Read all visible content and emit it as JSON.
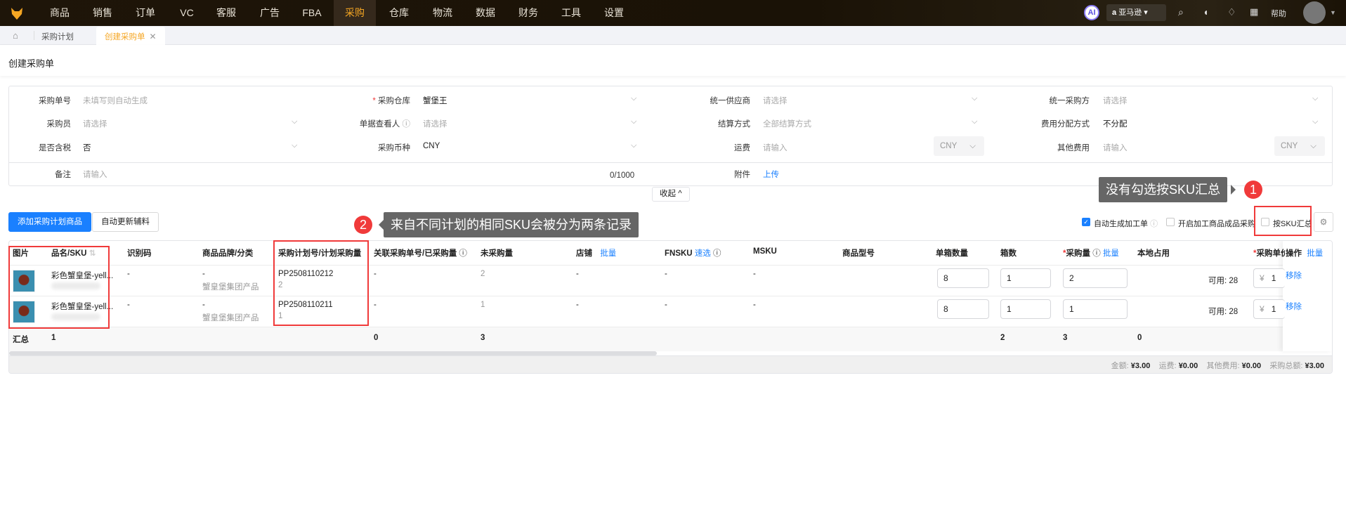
{
  "nav": {
    "items": [
      "商品",
      "销售",
      "订单",
      "VC",
      "客服",
      "广告",
      "FBA",
      "采购",
      "仓库",
      "物流",
      "数据",
      "财务",
      "工具",
      "设置"
    ],
    "active": "采购",
    "ai": "AI",
    "platform": "亚马逊",
    "help": "帮助"
  },
  "tabs": {
    "items": [
      "采购计划",
      "创建采购单"
    ],
    "active": "创建采购单"
  },
  "page_title": "创建采购单",
  "form": {
    "order_no": {
      "label": "采购单号",
      "placeholder": "未填写则自动生成"
    },
    "warehouse": {
      "label": "采购仓库",
      "value": "蟹堡王",
      "required": "*"
    },
    "supplier": {
      "label": "统一供应商",
      "placeholder": "请选择"
    },
    "buyer_party": {
      "label": "统一采购方",
      "placeholder": "请选择"
    },
    "buyer": {
      "label": "采购员",
      "placeholder": "请选择"
    },
    "viewer": {
      "label": "单据查看人",
      "placeholder": "请选择"
    },
    "settlement": {
      "label": "结算方式",
      "placeholder": "全部结算方式"
    },
    "cost_alloc": {
      "label": "费用分配方式",
      "value": "不分配"
    },
    "tax": {
      "label": "是否含税",
      "value": "否"
    },
    "currency": {
      "label": "采购币种",
      "value": "CNY"
    },
    "freight": {
      "label": "运费",
      "placeholder": "请输入",
      "currency": "CNY"
    },
    "other_fee": {
      "label": "其他费用",
      "placeholder": "请输入",
      "currency": "CNY"
    },
    "remark": {
      "label": "备注",
      "placeholder": "请输入",
      "counter": "0/1000"
    },
    "attachment": {
      "label": "附件",
      "upload": "上传"
    },
    "collapse": "收起"
  },
  "toolbar": {
    "add_plan_goods": "添加采购计划商品",
    "auto_update": "自动更新辅料",
    "auto_work_order": "自动生成加工单",
    "finished_purchase": "开启加工商品成品采购",
    "by_sku": "按SKU汇总"
  },
  "table": {
    "headers": {
      "img": "图片",
      "name": "品名/SKU",
      "code": "识别码",
      "brand": "商品品牌/分类",
      "plan": "采购计划号/计划采购量",
      "related": "关联采购单号/已采购量",
      "unpurchased": "未采购量",
      "shop": "店铺",
      "shop_batch": "批量",
      "fnsku": "FNSKU",
      "fnsku_quick": "速选",
      "msku": "MSKU",
      "model": "商品型号",
      "per_box": "单箱数量",
      "boxes": "箱数",
      "qty": "采购量",
      "qty_batch": "批量",
      "local": "本地占用",
      "price": "采购单价",
      "ops": "操作",
      "ops_batch": "批量"
    },
    "rows": [
      {
        "name": "彩色蟹皇堡-yell...",
        "code": "-",
        "brand": "-",
        "category": "蟹皇堡集团产品",
        "plan_no": "PP2508110212",
        "plan_qty": "2",
        "related": "-",
        "unpurchased": "2",
        "shop": "-",
        "fnsku": "-",
        "msku": "-",
        "per_box": "8",
        "boxes": "1",
        "qty": "2",
        "available": "可用: 28",
        "price_prefix": "¥",
        "price": "1",
        "remove": "移除"
      },
      {
        "name": "彩色蟹皇堡-yell...",
        "code": "-",
        "brand": "-",
        "category": "蟹皇堡集团产品",
        "plan_no": "PP2508110211",
        "plan_qty": "1",
        "related": "-",
        "unpurchased": "1",
        "shop": "-",
        "fnsku": "-",
        "msku": "-",
        "per_box": "8",
        "boxes": "1",
        "qty": "1",
        "available": "可用: 28",
        "price_prefix": "¥",
        "price": "1",
        "remove": "移除"
      }
    ],
    "summary": {
      "label": "汇总",
      "name": "1",
      "related": "0",
      "unpurchased": "3",
      "boxes": "2",
      "qty": "3",
      "local": "0"
    }
  },
  "footer": {
    "amount_label": "金额:",
    "amount": "¥3.00",
    "freight_label": "运费:",
    "freight": "¥0.00",
    "other_label": "其他费用:",
    "other": "¥0.00",
    "total_label": "采购总额:",
    "total": "¥3.00"
  },
  "annotations": {
    "tip1": "没有勾选按SKU汇总",
    "n1": "1",
    "tip2": "来自不同计划的相同SKU会被分为两条记录",
    "n2": "2"
  },
  "colors": {
    "accent": "#1a80ff",
    "active_nav": "#f5a623",
    "annotation": "#f03a3a"
  }
}
